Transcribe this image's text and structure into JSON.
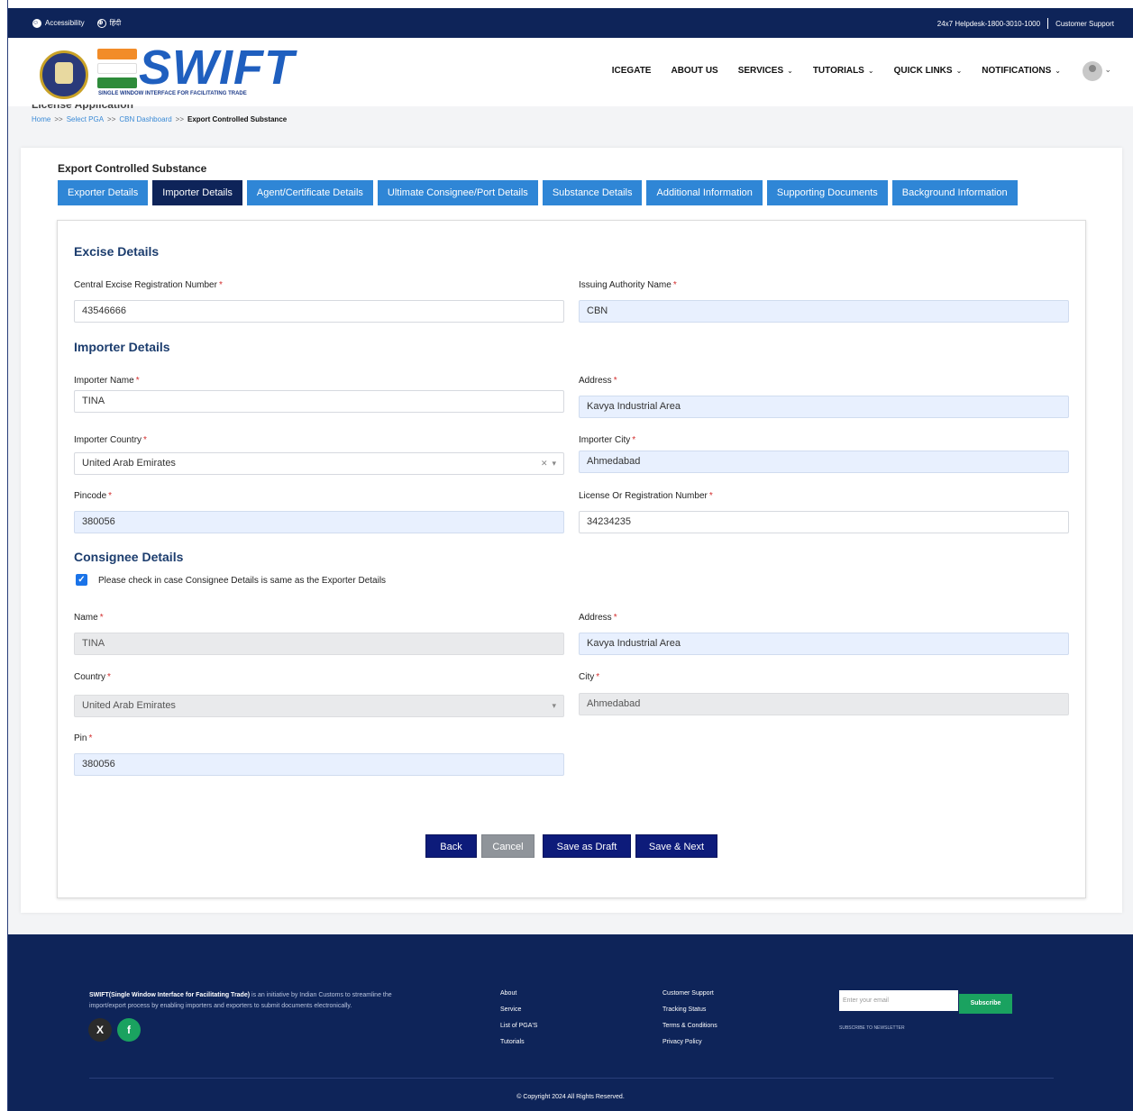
{
  "topbar": {
    "accessibility": "Accessibility",
    "hindi": "हिंदी",
    "helpdesk": "24x7 Helpdesk-1800-3010-1000",
    "customer_support": "Customer Support"
  },
  "header": {
    "logo_text": "SWIFT",
    "logo_subtitle": "SINGLE WINDOW INTERFACE FOR FACILITATING TRADE",
    "nav": [
      "ICEGATE",
      "ABOUT US",
      "SERVICES",
      "TUTORIALS",
      "QUICK LINKS",
      "NOTIFICATIONS"
    ]
  },
  "breadcrumb": {
    "page_title": "License Application",
    "items": [
      "Home",
      "Select PGA",
      "CBN Dashboard"
    ],
    "current": "Export Controlled Substance",
    "separator": ">>"
  },
  "form": {
    "title": "Export Controlled Substance",
    "tabs": [
      "Exporter Details",
      "Importer Details",
      "Agent/Certificate Details",
      "Ultimate Consignee/Port Details",
      "Substance Details",
      "Additional Information",
      "Supporting Documents",
      "Background Information"
    ],
    "active_tab": "Importer Details"
  },
  "excise": {
    "heading": "Excise Details",
    "reg_label": "Central Excise Registration Number",
    "reg_value": "43546666",
    "authority_label": "Issuing Authority Name",
    "authority_value": "CBN"
  },
  "importer": {
    "heading": "Importer Details",
    "name_label": "Importer Name",
    "name_value": "TINA",
    "address_label": "Address",
    "address_value": "Kavya Industrial Area",
    "country_label": "Importer Country",
    "country_value": "United Arab Emirates",
    "city_label": "Importer City",
    "city_value": "Ahmedabad",
    "pincode_label": "Pincode",
    "pincode_value": "380056",
    "license_label": "License Or Registration Number",
    "license_value": "34234235"
  },
  "consignee": {
    "heading": "Consignee Details",
    "same_as_exporter_label": "Please check in case Consignee Details is same as the Exporter Details",
    "same_as_exporter_checked": true,
    "name_label": "Name",
    "name_value": "TINA",
    "address_label": "Address",
    "address_value": "Kavya Industrial Area",
    "country_label": "Country",
    "country_value": "United Arab Emirates",
    "city_label": "City",
    "city_value": "Ahmedabad",
    "pin_label": "Pin",
    "pin_value": "380056"
  },
  "actions": {
    "back": "Back",
    "cancel": "Cancel",
    "save_draft": "Save as Draft",
    "save_next": "Save & Next"
  },
  "footer": {
    "about_bold": "SWIFT(Single Window Interface for Facilitating Trade)",
    "about_rest": " is an initiative by Indian Customs to streamline the import/export process by enabling importers and exporters to submit documents electronically.",
    "links_col1": [
      "About",
      "Service",
      "List of PGA'S",
      "Tutorials"
    ],
    "links_col2": [
      "Customer Support",
      "Tracking Status",
      "Terms & Conditions",
      "Privacy Policy"
    ],
    "email_placeholder": "Enter your email",
    "subscribe": "Subscribe",
    "newsletter": "SUBSCRIBE TO NEWSLETTER",
    "copyright": "© Copyright 2024 All Rights Reserved."
  },
  "colors": {
    "navy": "#0e2459",
    "tab_blue": "#2f86d6",
    "button_navy": "#0d1b7a",
    "green": "#1aa260"
  }
}
